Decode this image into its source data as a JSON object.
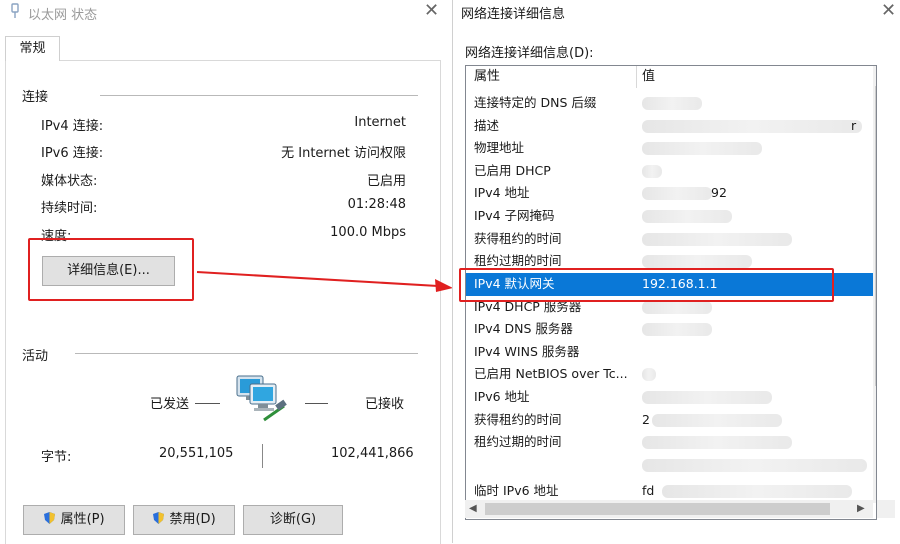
{
  "left_window": {
    "title": "以太网 状态",
    "tab": "常规",
    "connection": {
      "heading": "连接",
      "rows": [
        {
          "label": "IPv4 连接:",
          "value": "Internet"
        },
        {
          "label": "IPv6 连接:",
          "value": "无 Internet 访问权限"
        },
        {
          "label": "媒体状态:",
          "value": "已启用"
        },
        {
          "label": "持续时间:",
          "value": "01:28:48"
        },
        {
          "label": "速度:",
          "value": "100.0 Mbps"
        }
      ],
      "details_button": "详细信息(E)..."
    },
    "activity": {
      "heading": "活动",
      "sent": "已发送",
      "received": "已接收",
      "bytes_label": "字节:",
      "bytes_sent": "20,551,105",
      "bytes_received": "102,441,866"
    },
    "buttons": {
      "properties": "属性(P)",
      "disable": "禁用(D)",
      "diagnose": "诊断(G)"
    }
  },
  "right_window": {
    "title": "网络连接详细信息",
    "list_label": "网络连接详细信息(D):",
    "columns": {
      "property": "属性",
      "value": "值"
    },
    "rows": [
      {
        "key": "连接特定的 DNS 后缀",
        "value": ""
      },
      {
        "key": "描述",
        "value": "r"
      },
      {
        "key": "物理地址",
        "value": ""
      },
      {
        "key": "已启用 DHCP",
        "value": ""
      },
      {
        "key": "IPv4 地址",
        "value": "92"
      },
      {
        "key": "IPv4 子网掩码",
        "value": ""
      },
      {
        "key": "获得租约的时间",
        "value": ""
      },
      {
        "key": "租约过期的时间",
        "value": ""
      },
      {
        "key": "IPv4 默认网关",
        "value": "192.168.1.1"
      },
      {
        "key": "IPv4 DHCP 服务器",
        "value": ""
      },
      {
        "key": "IPv4 DNS 服务器",
        "value": ""
      },
      {
        "key": "IPv4 WINS 服务器",
        "value": ""
      },
      {
        "key": "已启用 NetBIOS over Tc...",
        "value": ""
      },
      {
        "key": "IPv6 地址",
        "value": ""
      },
      {
        "key": "获得租约的时间",
        "value": "2"
      },
      {
        "key": "租约过期的时间",
        "value": ""
      },
      {
        "key": "",
        "value": ""
      },
      {
        "key": "临时 IPv6 地址",
        "value": "fd"
      }
    ]
  },
  "colors": {
    "highlight": "#0a78d7",
    "annotation": "#e02020"
  }
}
